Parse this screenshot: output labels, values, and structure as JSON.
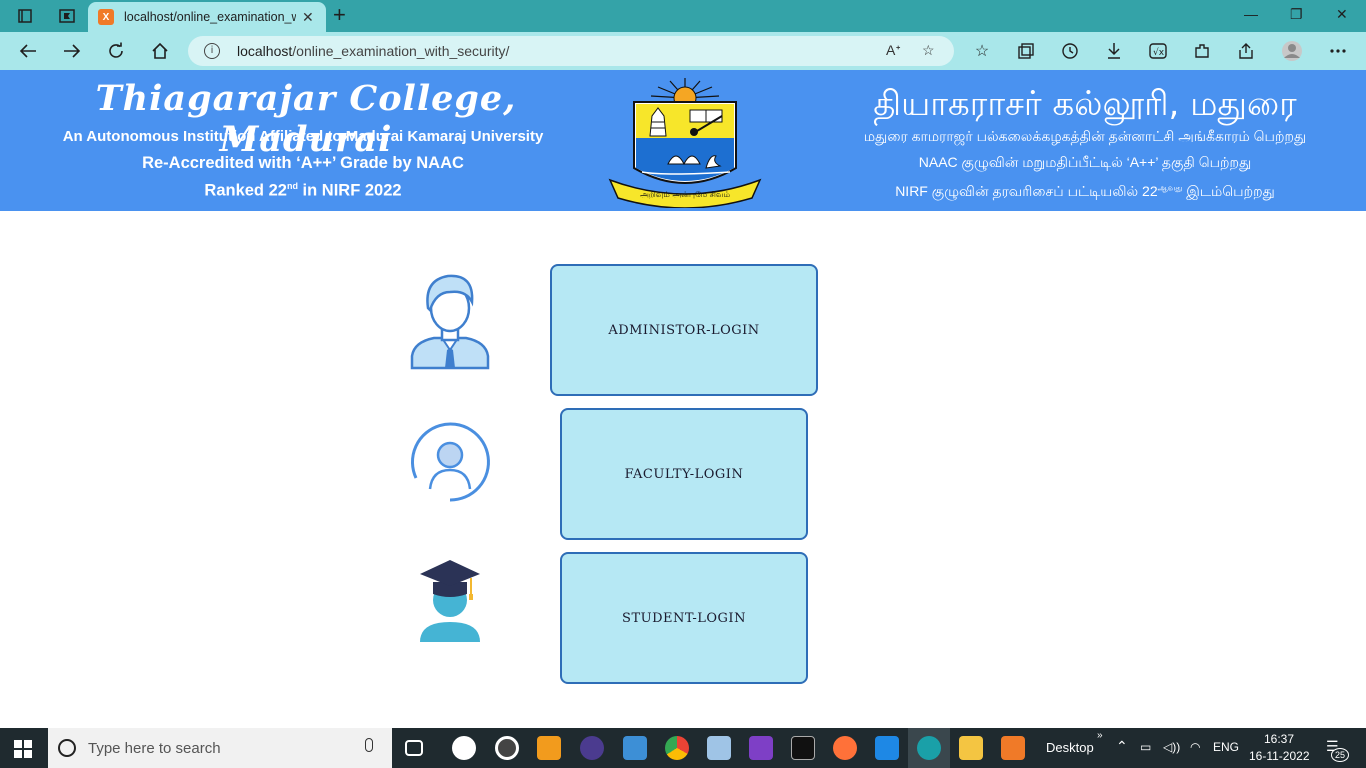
{
  "browser": {
    "tab_title": "localhost/online_examination_w",
    "tab_favicon": "xampp-icon",
    "url_host": "localhost",
    "url_path": "/online_examination_with_security/"
  },
  "banner": {
    "college_name_en": "Thiagarajar College, Madurai",
    "affiliation_en": "An Autonomous Institution Affiliated to Madurai Kamaraj University",
    "naac_en": "Re-Accredited with ‘A++’ Grade by NAAC",
    "nirf_en_prefix": "Ranked 22",
    "nirf_en_sup": "nd",
    "nirf_en_suffix": " in NIRF 2022",
    "college_name_ta": "தியாகராசர் கல்லூரி, மதுரை",
    "affiliation_ta": "மதுரை காமராஜர் பல்கலைக்கழகத்தின் தன்னாட்சி அங்கீகாரம் பெற்றது",
    "naac_ta": "NAAC குழுவின் மறுமதிப்பீட்டில் ‘A++’ தகுதி பெற்றது",
    "nirf_ta_prefix": "NIRF குழுவின் தரவரிசைப் பட்டியலில் 22",
    "nirf_ta_sup": "ஆவது",
    "nirf_ta_suffix": " இடம்பெற்றது",
    "emblem_motto": "அறிவும் அன்புமே சிவம்",
    "colors": {
      "background": "#4a92f0",
      "text": "#ffffff"
    }
  },
  "logins": {
    "administrator": {
      "label": "ADMINISTOR-LOGIN",
      "icon": "administrator-avatar-icon"
    },
    "faculty": {
      "label": "FACULTY-LOGIN",
      "icon": "user-circle-icon"
    },
    "student": {
      "label": "STUDENT-LOGIN",
      "icon": "graduate-icon"
    },
    "colors": {
      "button_fill": "#b6e8f4",
      "button_border": "#2e6db7"
    }
  },
  "taskbar": {
    "search_placeholder": "Type here to search",
    "desktop_label": "Desktop",
    "language": "ENG",
    "time": "16:37",
    "date": "16-11-2022",
    "notification_count": "25"
  }
}
